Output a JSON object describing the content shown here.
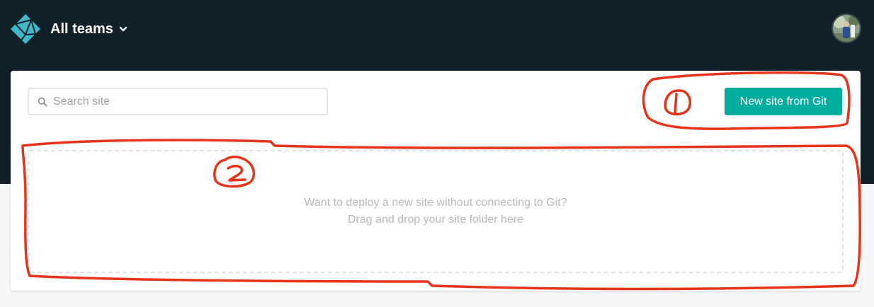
{
  "header": {
    "team_label": "All teams",
    "logo_icon": "netlify-logo-icon",
    "avatar_icon": "user-avatar-icon",
    "background_color": "#12202a"
  },
  "toolbar": {
    "search_placeholder": "Search site",
    "new_site_button": "New site from Git",
    "accent_color": "#00ad9f"
  },
  "dropzone": {
    "line1": "Want to deploy a new site without connecting to Git?",
    "line2": "Drag and drop your site folder here"
  },
  "annotations": {
    "color": "#e8321a",
    "marker1": "①",
    "marker2": "②"
  }
}
